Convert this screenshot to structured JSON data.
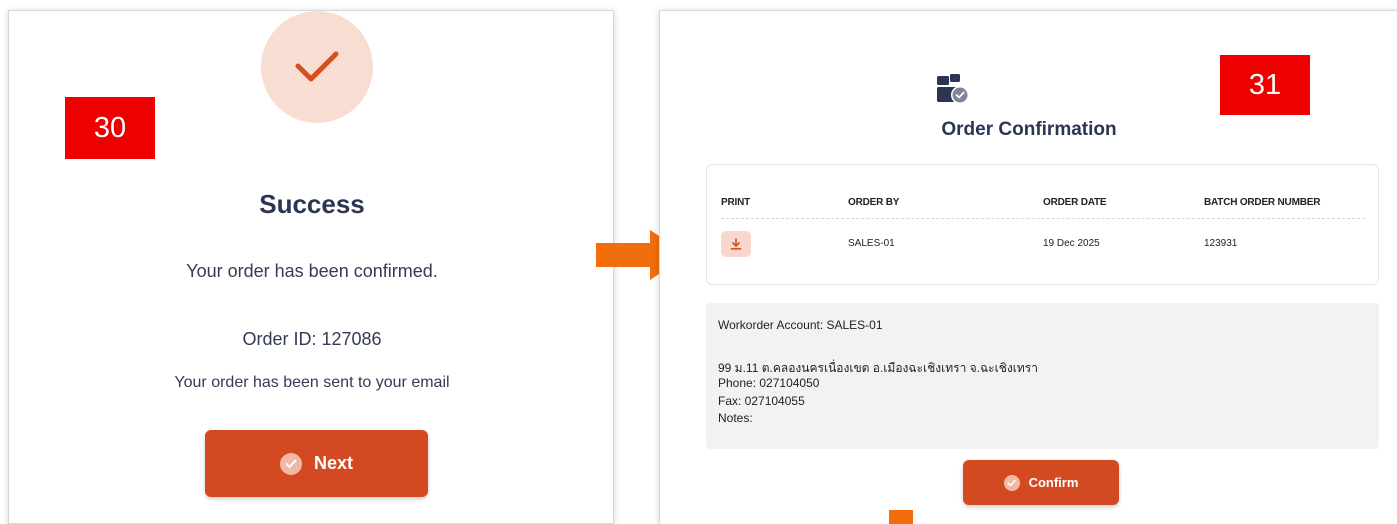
{
  "step_left": {
    "badge": "30"
  },
  "success": {
    "title": "Success",
    "message": "Your order has been confirmed.",
    "order_id": "Order ID: 127086",
    "email_note": "Your order has been sent to your email",
    "next_label": "Next"
  },
  "step_right": {
    "badge": "31"
  },
  "confirmation": {
    "title": "Order Confirmation",
    "table": {
      "headers": [
        "PRINT",
        "ORDER BY",
        "ORDER DATE",
        "BATCH ORDER NUMBER"
      ],
      "row": {
        "order_by": "SALES-01",
        "order_date": "19 Dec 2025",
        "batch_number": "123931"
      }
    },
    "account": {
      "workorder": "Workorder Account: SALES-01",
      "address": "99 ม.11 ต.คลองนครเนื่องเขต อ.เมืองฉะเชิงเทรา จ.ฉะเชิงเทรา",
      "phone": "Phone: 027104050",
      "fax": "Fax: 027104055",
      "notes": "Notes:"
    },
    "confirm_label": "Confirm"
  },
  "icons": {
    "success": "checkmark-icon",
    "next": "check-circle-icon",
    "order": "package-check-icon",
    "print": "download-icon",
    "confirm": "check-circle-icon",
    "flow_arrow": "arrow-right-icon"
  },
  "colors": {
    "accent": "#d34a22",
    "accent_soft": "#f8ddd3",
    "badge": "#ee0000",
    "arrow": "#f26d0c",
    "title": "#2c3553"
  }
}
